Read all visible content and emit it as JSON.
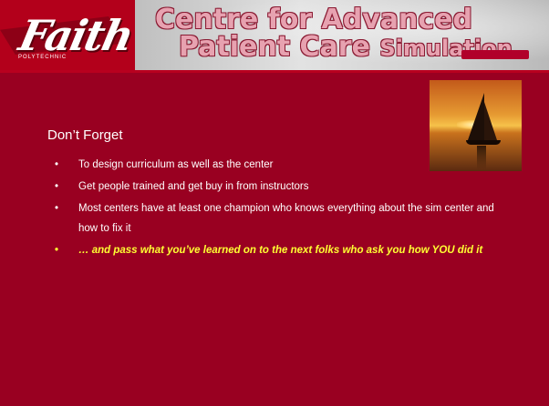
{
  "banner": {
    "logo_text": "Faith",
    "logo_subtext": "POLYTECHNIC",
    "line1": "Centre for Advanced",
    "line2_big": "Patient Care ",
    "line2_small": "Simulation"
  },
  "slide": {
    "title": "Don’t Forget",
    "bullet_glyph": "•",
    "bullets": [
      {
        "text": "To design curriculum as well as the center"
      },
      {
        "text": "Get people trained and get buy in from instructors"
      },
      {
        "text": "Most centers have at least one champion who knows everything about the sim center and how to fix it"
      },
      {
        "text": "… and pass what you’ve learned on to the next folks who ask you how YOU did it"
      }
    ]
  },
  "colors": {
    "background": "#990021",
    "text": "#ffffff",
    "highlight": "#ffff33"
  }
}
